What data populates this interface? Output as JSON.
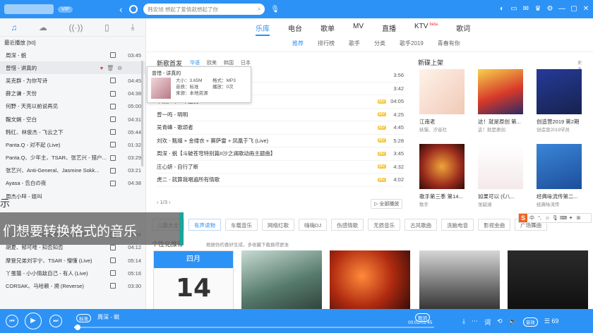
{
  "titlebar": {
    "vip": "VIP",
    "search_placeholder": "韩安旭 想起了爱情就想起了你",
    "icons": [
      "skin-icon",
      "message-icon",
      "mail-icon",
      "vip-icon",
      "settings-icon",
      "minimize-icon",
      "mini-mode-icon",
      "close-icon"
    ]
  },
  "left": {
    "tabs": [
      "music-note-icon",
      "cloud-icon",
      "radio-icon",
      "phone-icon",
      "download-icon"
    ],
    "recent_head": "最近播放 [50]",
    "tracks": [
      {
        "name": "周深 - 蜕",
        "dur": "03:45"
      },
      {
        "name": "曾惜 - 讲真的",
        "dur": "",
        "selected": true
      },
      {
        "name": "吴克群 - 为你写诗",
        "dur": "04:45"
      },
      {
        "name": "薛之谦 - 天份",
        "dur": "04:38"
      },
      {
        "name": "何野 - 天亮以前说再见",
        "dur": "05:00"
      },
      {
        "name": "鞠文娴 - 空白",
        "dur": "04:31"
      },
      {
        "name": "韩红、林俊杰 - 飞云之下",
        "dur": "05:44"
      },
      {
        "name": "Panta.Q - 对不起 (Live)",
        "dur": "01:32"
      },
      {
        "name": "Panta.Q、少年主、TSAR、张艺兴 - 猎户...",
        "dur": "03:29"
      },
      {
        "name": "张艺兴、Anti-General、Jasmine Sokk...",
        "dur": "03:21"
      },
      {
        "name": "Ayasa - 告白の夜",
        "dur": "04:38"
      },
      {
        "name": "周杰小咩 - 姐叫",
        "dur": ""
      },
      {
        "name": "",
        "dur": ""
      },
      {
        "name": "",
        "dur": ""
      },
      {
        "name": "太一 - 佛曰不见的晚到后突然拥抱你",
        "dur": "02:44"
      },
      {
        "name": "胡夏、郁可唯 - 知否知否",
        "dur": "04:12"
      },
      {
        "name": "摩登兄弟刘宇宁、TSAR - 懵懂 (Live)",
        "dur": "05:14"
      },
      {
        "name": "丫蛋猫 - 小小情敌自己 - 有人 (Live)",
        "dur": "05:16"
      },
      {
        "name": "CORSAK、马哈赖 - 溯 (Reverse)",
        "dur": "03:30"
      }
    ]
  },
  "main": {
    "tabs": [
      "乐库",
      "电台",
      "歌单",
      "MV",
      "直播",
      "KTV",
      "歌词"
    ],
    "ktv_badge": "beta",
    "sub_tabs": [
      "推荐",
      "排行榜",
      "歌手",
      "分类",
      "歌手2019",
      "青春有你"
    ],
    "new_songs_title": "新歌首发",
    "regions": [
      "华语",
      "欧美",
      "韩国",
      "日本"
    ],
    "songs": [
      {
        "name": "",
        "dur": "3:56"
      },
      {
        "name": "",
        "dur": "3:42"
      },
      {
        "name": "木及少年 - 单独我",
        "dur": "04:05"
      },
      {
        "name": "曾一鸣 - 明明",
        "dur": "4:25"
      },
      {
        "name": "吴青峰 - 歌颂者",
        "dur": "4:45"
      },
      {
        "name": "刘欢 - 甄嬛 + 金缕衣 + 赛萨雷 + 凤凰于飞 (Live)",
        "dur": "5:28"
      },
      {
        "name": "周深 - 蜕【斗破苍穹特别篇II沙之澜歌动画主题曲】",
        "dur": "3:45"
      },
      {
        "name": "庄心妍 - 自行了断",
        "dur": "4:32"
      },
      {
        "name": "虎二 - 就算我唱遍所有情歌",
        "dur": "4:02"
      }
    ],
    "pager": "1/3",
    "play_all": "全部播放",
    "tooltip": {
      "title": "曾惜 - 讲真的",
      "size": "大小：3.65M",
      "quality": "音质：标准",
      "source": "来源：本地资源",
      "format": "格式：MP3",
      "plays": "播放：0次"
    },
    "albums_title": "新碟上架",
    "more": "更多",
    "albums": [
      {
        "title": "江南老",
        "artist": "妖猫、汐音社"
      },
      {
        "title": "这！就是原创 第...",
        "artist": "这！就是原创"
      },
      {
        "title": "创造营2019 第2期",
        "artist": "创造营2019学员"
      },
      {
        "title": "歌手第三季 第14...",
        "artist": "歌手"
      },
      {
        "title": "如果可以 (《八...",
        "artist": "张韶涵"
      },
      {
        "title": "经典咏流传第二...",
        "artist": "经典咏流传"
      }
    ],
    "tags": [
      "儿歌大全",
      "有声读物",
      "车载音乐",
      "网络红歌",
      "嗨嗨DJ",
      "伤感情歌",
      "无损音乐",
      "古风歌曲",
      "洗脑电音",
      "影视金曲",
      "广场舞曲"
    ],
    "personal_title": "个性化推荐",
    "personal_sub": "根据你的喜好生成，多收藏下载换得更准",
    "calendar_month": "四月",
    "calendar_day": "14"
  },
  "overlay": {
    "fragment": "示",
    "caption": "们想要转换格式的音乐"
  },
  "player": {
    "quality": "标准",
    "now_playing": "周深 - 蜕",
    "lyric": "歌词",
    "time": "00:02/03:45",
    "progress": 0.01,
    "sound_effect": "音效",
    "count": "69"
  }
}
